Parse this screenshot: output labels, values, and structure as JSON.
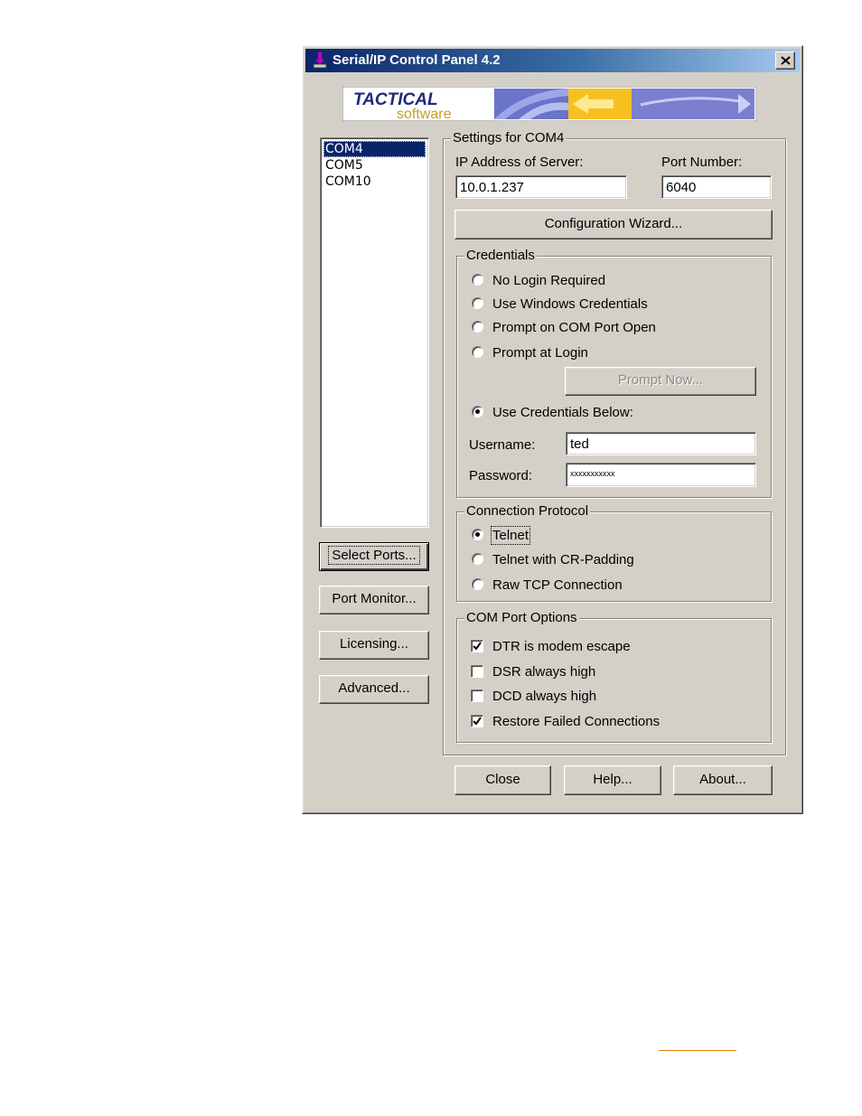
{
  "window": {
    "title": "Serial/IP Control Panel 4.2",
    "close_icon": "close-icon"
  },
  "banner": {
    "brand_top": "TACTICAL",
    "brand_bottom": "software"
  },
  "port_list": {
    "items": [
      {
        "label": "COM4",
        "selected": true
      },
      {
        "label": "COM5",
        "selected": false
      },
      {
        "label": "COM10",
        "selected": false
      }
    ]
  },
  "left_buttons": {
    "select_ports": "Select Ports...",
    "port_monitor": "Port Monitor...",
    "licensing": "Licensing...",
    "advanced": "Advanced..."
  },
  "settings": {
    "group_title": "Settings for COM4",
    "ip_label": "IP Address of Server:",
    "ip_value": "10.0.1.237",
    "port_label": "Port Number:",
    "port_value": "6040",
    "wizard_button": "Configuration Wizard..."
  },
  "credentials": {
    "group_title": "Credentials",
    "options": [
      {
        "label": "No Login Required",
        "checked": false
      },
      {
        "label": "Use Windows Credentials",
        "checked": false
      },
      {
        "label": "Prompt on COM Port Open",
        "checked": false
      },
      {
        "label": "Prompt at Login",
        "checked": false
      },
      {
        "label": "Use Credentials Below:",
        "checked": true
      }
    ],
    "prompt_now_button": "Prompt Now...",
    "username_label": "Username:",
    "username_value": "ted",
    "password_label": "Password:",
    "password_value": "xxxxxxxxxxx"
  },
  "protocol": {
    "group_title": "Connection Protocol",
    "options": [
      {
        "label": "Telnet",
        "checked": true
      },
      {
        "label": "Telnet with CR-Padding",
        "checked": false
      },
      {
        "label": "Raw TCP Connection",
        "checked": false
      }
    ]
  },
  "com_options": {
    "group_title": "COM Port Options",
    "options": [
      {
        "label": "DTR is modem escape",
        "checked": true
      },
      {
        "label": "DSR always high",
        "checked": false
      },
      {
        "label": "DCD always high",
        "checked": false
      },
      {
        "label": "Restore Failed Connections",
        "checked": true
      }
    ]
  },
  "bottom_buttons": {
    "close": "Close",
    "help": "Help...",
    "about": "About..."
  },
  "colors": {
    "face": "#d4d0c8",
    "title_start": "#0a246a",
    "title_end": "#a6caf0",
    "link": "#e07a00"
  }
}
